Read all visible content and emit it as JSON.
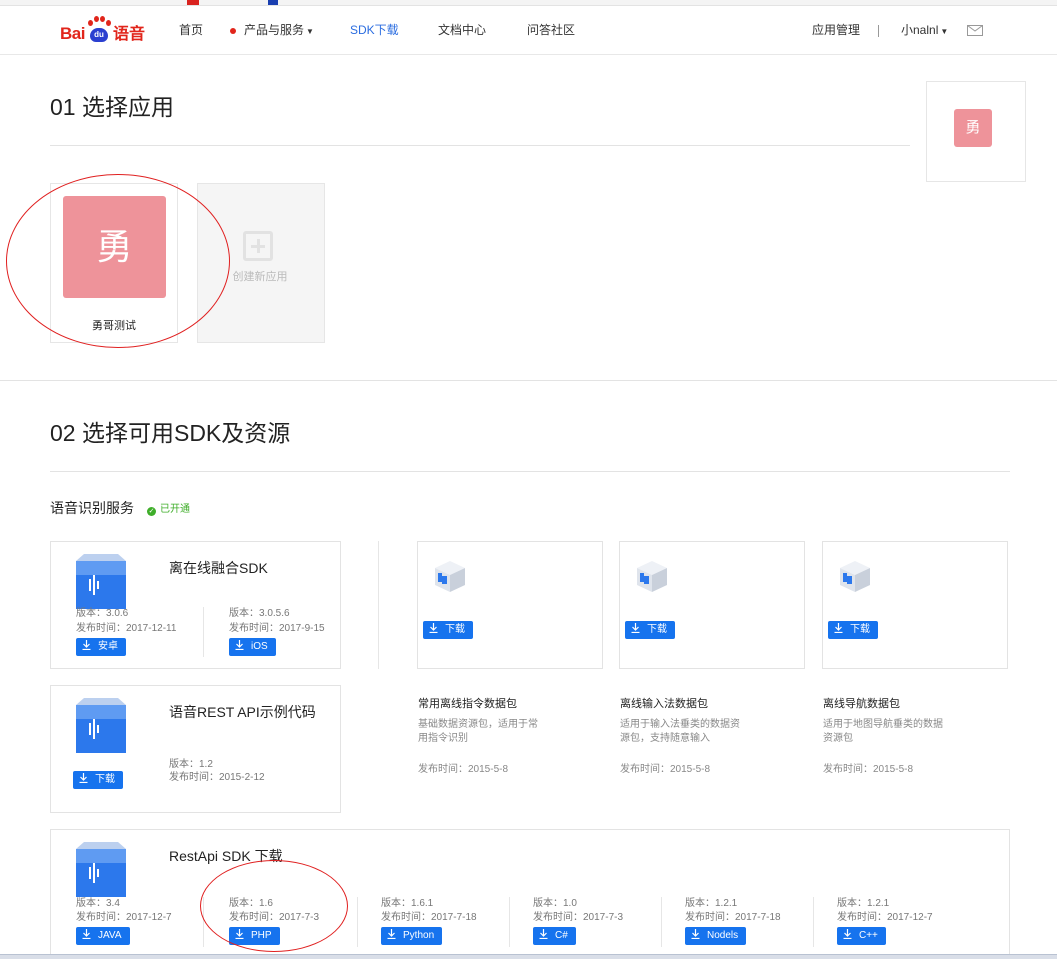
{
  "header": {
    "logo": {
      "bai": "Bai",
      "du": "du",
      "suffix": "语音"
    },
    "nav": [
      {
        "label": "首页"
      },
      {
        "label": "产品与服务"
      },
      {
        "label": "SDK下载"
      },
      {
        "label": "文档中心"
      },
      {
        "label": "问答社区"
      }
    ],
    "app_manage": "应用管理",
    "user": "小nalnl"
  },
  "section1": {
    "title": "01 选择应用",
    "app": {
      "tile_char": "勇",
      "name": "勇哥测试"
    },
    "new_app_label": "创建新应用",
    "side_tile_char": "勇"
  },
  "section2": {
    "title": "02 选择可用SDK及资源",
    "service_label": "语音识别服务",
    "service_status": "已开通"
  },
  "cards": {
    "offline_sdk": {
      "title": "离在线融合SDK",
      "versions": [
        {
          "version": "版本：3.0.6",
          "date": "发布时间：2017-12-11",
          "button": "安卓"
        },
        {
          "version": "版本：3.0.5.6",
          "date": "发布时间：2017-9-15",
          "button": "iOS"
        }
      ]
    },
    "rest_demo": {
      "title": "语音REST API示例代码",
      "version": "版本：1.2",
      "date": "发布时间：2015-2-12",
      "button": "下载"
    },
    "restapi_sdk": {
      "title": "RestApi SDK 下载",
      "versions": [
        {
          "version": "版本：3.4",
          "date": "发布时间：2017-12-7",
          "button": "JAVA"
        },
        {
          "version": "版本：1.6",
          "date": "发布时间：2017-7-3",
          "button": "PHP"
        },
        {
          "version": "版本：1.6.1",
          "date": "发布时间：2017-7-18",
          "button": "Python"
        },
        {
          "version": "版本：1.0",
          "date": "发布时间：2017-7-3",
          "button": "C#"
        },
        {
          "version": "版本：1.2.1",
          "date": "发布时间：2017-7-18",
          "button": "Nodels"
        },
        {
          "version": "版本：1.2.1",
          "date": "发布时间：2017-12-7",
          "button": "C++"
        }
      ]
    }
  },
  "packages": [
    {
      "button": "下载",
      "title": "常用离线指令数据包",
      "desc1": "基础数据资源包，适用于常",
      "desc2": "用指令识别",
      "date": "发布时间：2015-5-8"
    },
    {
      "button": "下载",
      "title": "离线输入法数据包",
      "desc1": "适用于输入法垂类的数据资",
      "desc2": "源包，支持随意输入",
      "date": "发布时间：2015-5-8"
    },
    {
      "button": "下载",
      "title": "离线导航数据包",
      "desc1": "适用于地图导航垂类的数据",
      "desc2": "资源包",
      "date": "发布时间：2015-5-8"
    }
  ],
  "colors": {
    "accent": "#1673ee",
    "tile": "#ee939a",
    "brand_red": "#e1251b",
    "annotation": "#e02020"
  }
}
